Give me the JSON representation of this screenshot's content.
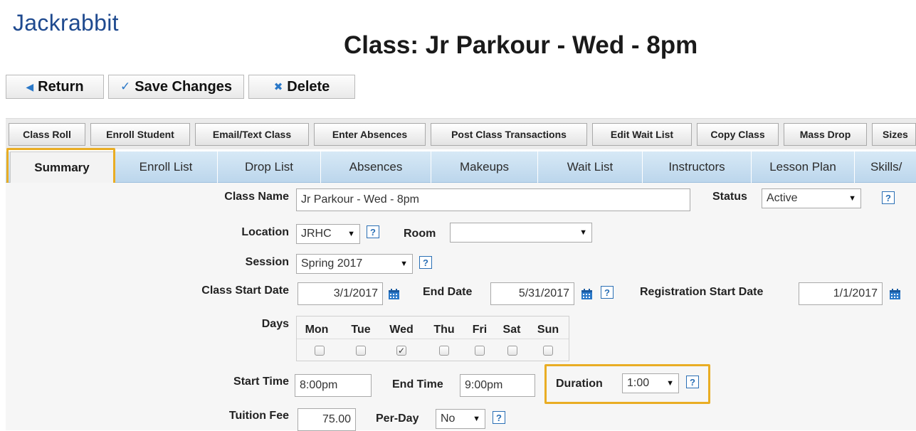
{
  "app": {
    "logo": "Jackrabbit"
  },
  "page": {
    "title": "Class: Jr Parkour - Wed - 8pm"
  },
  "top_buttons": {
    "return": "Return",
    "save": "Save Changes",
    "delete": "Delete"
  },
  "toolbar": {
    "class_roll": "Class Roll",
    "enroll_student": "Enroll Student",
    "email_text_class": "Email/Text Class",
    "enter_absences": "Enter Absences",
    "post_class_transactions": "Post Class Transactions",
    "edit_wait_list": "Edit Wait List",
    "copy_class": "Copy Class",
    "mass_drop": "Mass Drop",
    "sizes": "Sizes"
  },
  "tabs": {
    "summary": "Summary",
    "enroll_list": "Enroll List",
    "drop_list": "Drop List",
    "absences": "Absences",
    "makeups": "Makeups",
    "wait_list": "Wait List",
    "instructors": "Instructors",
    "lesson_plan": "Lesson Plan",
    "skills": "Skills/"
  },
  "form": {
    "class_name": {
      "label": "Class Name",
      "value": "Jr Parkour - Wed - 8pm"
    },
    "status": {
      "label": "Status",
      "value": "Active"
    },
    "location": {
      "label": "Location",
      "value": "JRHC"
    },
    "room": {
      "label": "Room",
      "value": ""
    },
    "session": {
      "label": "Session",
      "value": "Spring 2017"
    },
    "class_start_date": {
      "label": "Class Start Date",
      "value": "3/1/2017"
    },
    "end_date": {
      "label": "End Date",
      "value": "5/31/2017"
    },
    "registration_start_date": {
      "label": "Registration Start Date",
      "value": "1/1/2017"
    },
    "days": {
      "label": "Days",
      "mon": "Mon",
      "tue": "Tue",
      "wed": "Wed",
      "thu": "Thu",
      "fri": "Fri",
      "sat": "Sat",
      "sun": "Sun",
      "checked": [
        "Wed"
      ]
    },
    "start_time": {
      "label": "Start Time",
      "value": "8:00pm"
    },
    "end_time": {
      "label": "End Time",
      "value": "9:00pm"
    },
    "duration": {
      "label": "Duration",
      "value": "1:00"
    },
    "tuition_fee": {
      "label": "Tuition Fee",
      "value": "75.00"
    },
    "per_day": {
      "label": "Per-Day",
      "value": "No"
    }
  },
  "icons": {
    "help": "?",
    "check": "✓"
  },
  "colors": {
    "logo": "#1f4a8f",
    "highlight": "#e9ad24",
    "tab_bar": "#c7def1",
    "help_icon": "#2a6fb5"
  }
}
